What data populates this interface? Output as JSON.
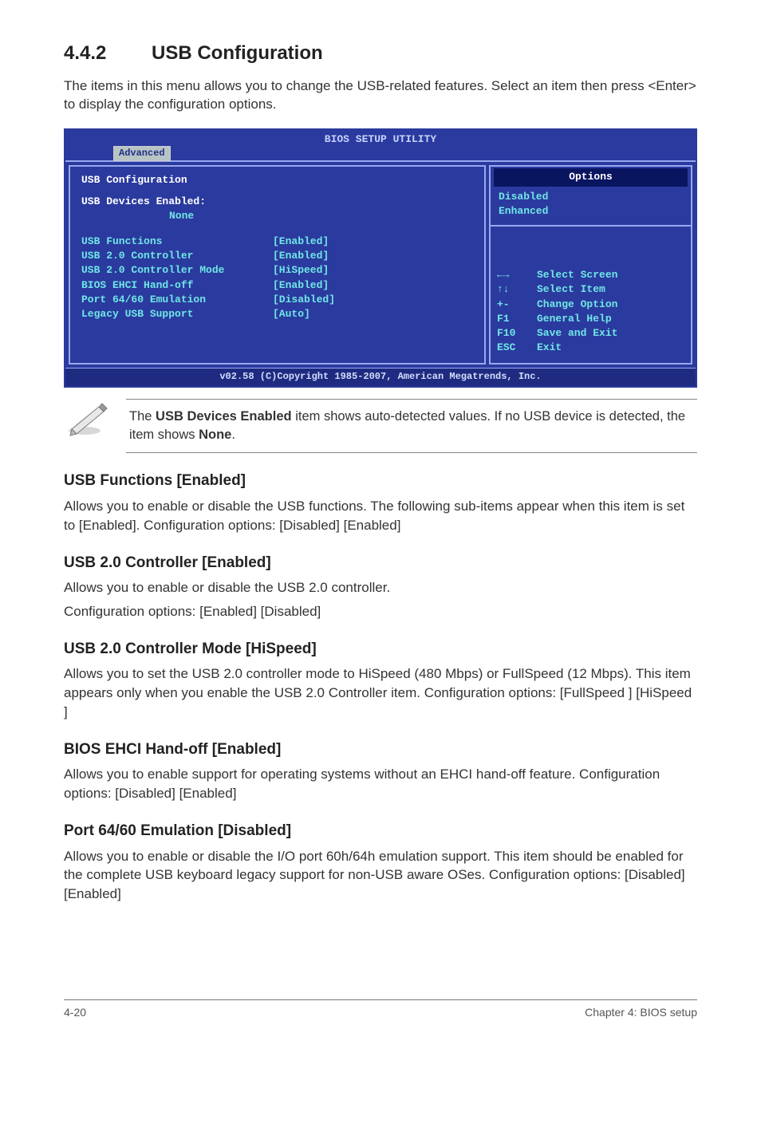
{
  "section": {
    "number": "4.4.2",
    "title": "USB Configuration",
    "intro": "The items in this menu allows you to change the USB-related features. Select an item then press <Enter> to display the configuration options."
  },
  "bios": {
    "title": "BIOS SETUP UTILITY",
    "tab": "Advanced",
    "left_heading": "USB Configuration",
    "devices_label": "USB Devices Enabled:",
    "devices_value": "None",
    "items": [
      {
        "label": "USB Functions",
        "value": "[Enabled]"
      },
      {
        "label": "USB 2.0 Controller",
        "value": "[Enabled]"
      },
      {
        "label": "USB 2.0 Controller Mode",
        "value": "[HiSpeed]"
      },
      {
        "label": "BIOS EHCI Hand-off",
        "value": "[Enabled]"
      },
      {
        "label": "Port 64/60 Emulation",
        "value": "[Disabled]"
      },
      {
        "label": "Legacy USB Support",
        "value": "[Auto]"
      }
    ],
    "options_header": "Options",
    "options": [
      "Disabled",
      "Enhanced"
    ],
    "help": [
      {
        "key": "←→",
        "text": "Select Screen"
      },
      {
        "key": "↑↓",
        "text": "Select Item"
      },
      {
        "key": "+-",
        "text": "Change Option"
      },
      {
        "key": "F1",
        "text": "General Help"
      },
      {
        "key": "F10",
        "text": "Save and Exit"
      },
      {
        "key": "ESC",
        "text": "Exit"
      }
    ],
    "footer": "v02.58 (C)Copyright 1985-2007, American Megatrends, Inc."
  },
  "note": "The USB Devices Enabled item shows auto-detected values. If no USB device is detected, the item shows None.",
  "note_bold1": "USB Devices Enabled",
  "note_bold2": "None",
  "subs": {
    "usb_functions": {
      "title": "USB Functions [Enabled]",
      "body": "Allows you to enable or disable the USB functions. The following sub-items appear when this item is set to [Enabled]. Configuration options: [Disabled] [Enabled]"
    },
    "usb20_controller": {
      "title": "USB 2.0 Controller [Enabled]",
      "body1": "Allows you to enable or disable the USB 2.0 controller.",
      "body2": "Configuration options: [Enabled] [Disabled]"
    },
    "usb20_mode": {
      "title": "USB 2.0 Controller Mode [HiSpeed]",
      "body": "Allows you to set the USB 2.0 controller mode to HiSpeed (480 Mbps) or FullSpeed (12 Mbps). This item appears only when you enable the USB 2.0 Controller item. Configuration options: [FullSpeed ] [HiSpeed ]"
    },
    "ehci": {
      "title": "BIOS EHCI Hand-off [Enabled]",
      "body": "Allows you to enable support for operating systems without an EHCI hand-off feature. Configuration options: [Disabled] [Enabled]"
    },
    "port6460": {
      "title": "Port 64/60 Emulation [Disabled]",
      "body": "Allows you to enable or disable the I/O port 60h/64h emulation support. This item should be enabled for the complete USB keyboard legacy support for non-USB aware OSes. Configuration options: [Disabled] [Enabled]"
    }
  },
  "footer": {
    "left": "4-20",
    "right": "Chapter 4: BIOS setup"
  }
}
